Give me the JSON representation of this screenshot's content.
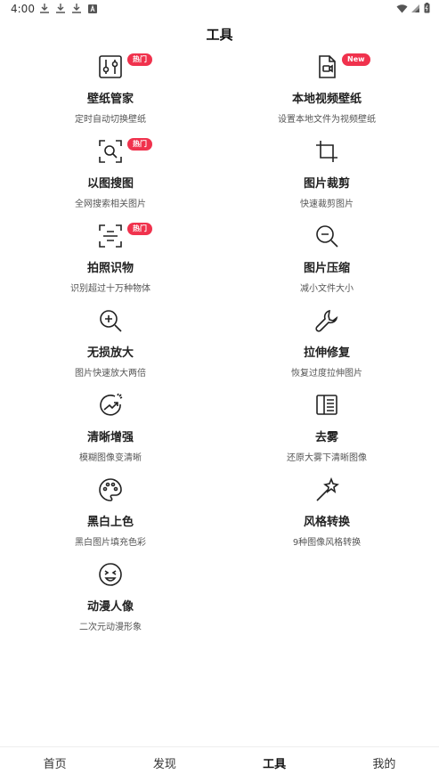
{
  "status": {
    "time": "4:00"
  },
  "page": {
    "title": "工具"
  },
  "tools": [
    {
      "name": "壁纸管家",
      "desc": "定时自动切换壁纸",
      "badge": "热门",
      "icon": "wallpaper-manager-icon"
    },
    {
      "name": "本地视频壁纸",
      "desc": "设置本地文件为视频壁纸",
      "badge": "New",
      "icon": "video-file-icon"
    },
    {
      "name": "以图搜图",
      "desc": "全网搜索相关图片",
      "badge": "热门",
      "icon": "image-search-icon"
    },
    {
      "name": "图片裁剪",
      "desc": "快速裁剪图片",
      "badge": "",
      "icon": "crop-icon"
    },
    {
      "name": "拍照识物",
      "desc": "识别超过十万种物体",
      "badge": "热门",
      "icon": "scan-object-icon"
    },
    {
      "name": "图片压缩",
      "desc": "减小文件大小",
      "badge": "",
      "icon": "zoom-out-icon"
    },
    {
      "name": "无损放大",
      "desc": "图片快速放大两倍",
      "badge": "",
      "icon": "zoom-in-icon"
    },
    {
      "name": "拉伸修复",
      "desc": "恢复过度拉伸图片",
      "badge": "",
      "icon": "wrench-icon"
    },
    {
      "name": "清晰增强",
      "desc": "模糊图像变清晰",
      "badge": "",
      "icon": "enhance-icon"
    },
    {
      "name": "去雾",
      "desc": "还原大雾下清晰图像",
      "badge": "",
      "icon": "dehaze-icon"
    },
    {
      "name": "黑白上色",
      "desc": "黑白图片填充色彩",
      "badge": "",
      "icon": "palette-icon"
    },
    {
      "name": "风格转换",
      "desc": "9种图像风格转换",
      "badge": "",
      "icon": "magic-wand-icon"
    },
    {
      "name": "动漫人像",
      "desc": "二次元动漫形象",
      "badge": "",
      "icon": "anime-face-icon"
    }
  ],
  "nav": {
    "home": "首页",
    "discover": "发现",
    "tools": "工具",
    "mine": "我的"
  },
  "colors": {
    "badge": "#f0324d",
    "text": "#222222"
  }
}
